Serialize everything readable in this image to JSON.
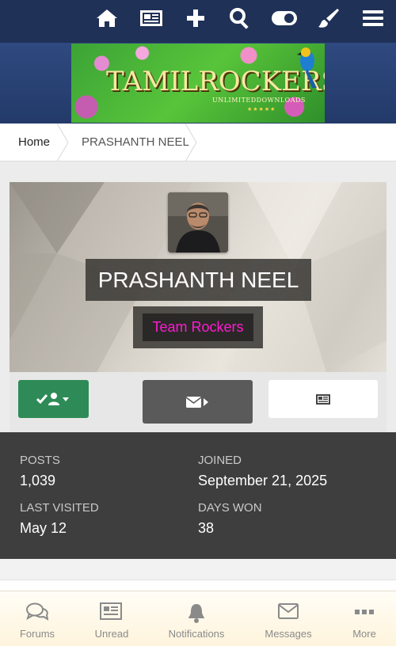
{
  "topnav": {
    "icons": [
      "home-icon",
      "newspaper-icon",
      "plus-icon",
      "search-icon",
      "toggle-icon",
      "brush-icon",
      "menu-icon"
    ]
  },
  "banner": {
    "title": "TAMILROCKERS",
    "tagline": "UNLIMITEDDOWNLOADS",
    "stars": "★★★★★"
  },
  "breadcrumb": {
    "home": "Home",
    "current": "PRASHANTH NEEL"
  },
  "profile": {
    "name": "PRASHANTH NEEL",
    "group": "Team Rockers",
    "group_color": "#ff1ad4"
  },
  "actions": {
    "follow_icon": "check-user-icon",
    "message_icon": "envelope-icon",
    "content_icon": "newspaper-icon"
  },
  "stats": {
    "posts_label": "POSTS",
    "posts_value": "1,039",
    "joined_label": "JOINED",
    "joined_value": "September 21, 2025",
    "last_visited_label": "LAST VISITED",
    "last_visited_value": "May 12",
    "days_won_label": "DAYS WON",
    "days_won_value": "38"
  },
  "bottom_nav": [
    {
      "label": "Forums",
      "icon": "chat-icon"
    },
    {
      "label": "Unread",
      "icon": "newspaper-icon"
    },
    {
      "label": "Notifications",
      "icon": "bell-icon"
    },
    {
      "label": "Messages",
      "icon": "envelope-icon"
    },
    {
      "label": "More",
      "icon": "more-icon"
    }
  ],
  "colors": {
    "topbar": "#1f3156",
    "follow_button": "#2e8b57",
    "message_button": "#5a5a5a",
    "stats_bg": "#3e3e3e"
  }
}
